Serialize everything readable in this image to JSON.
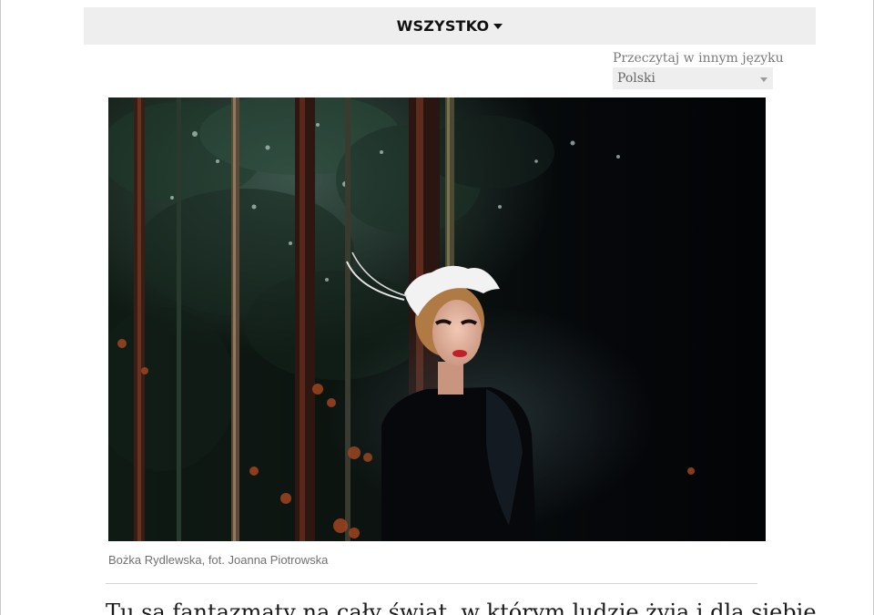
{
  "nav": {
    "filter_label": "WSZYSTKO"
  },
  "language": {
    "label": "Przeczytaj w innym języku",
    "selected": "Polski"
  },
  "photo": {
    "caption": "Bożka Rydlewska, fot. Joanna Piotrowska"
  },
  "article": {
    "lead_text": "Tu są fantazmaty na cały świat, w którym ludzie żyją i dla siebie."
  }
}
